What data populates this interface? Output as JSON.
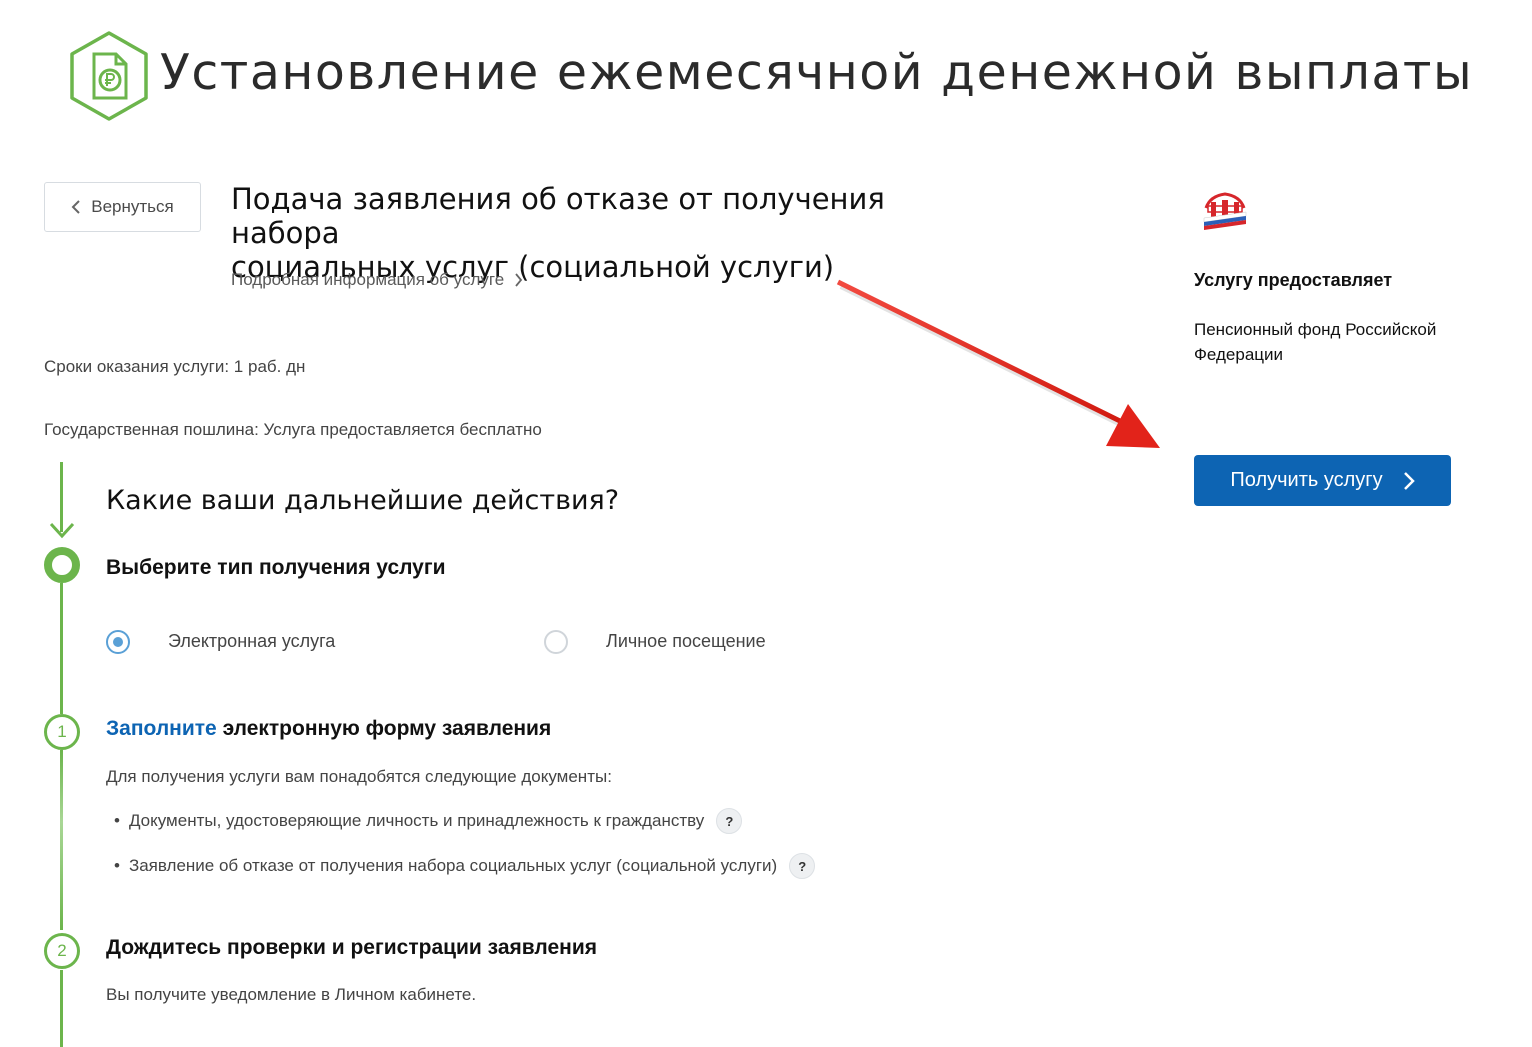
{
  "header": {
    "title": "Установление ежемесячной денежной выплаты",
    "logo_icon": "ruble-document-icon"
  },
  "back_button": {
    "label": "Вернуться",
    "icon": "chevron-left-icon"
  },
  "service": {
    "title_line1": "Подача заявления об отказе от получения набора",
    "title_line2": "социальных услуг (социальной услуги)",
    "more_info": "Подробная информация об услуге",
    "terms": "Сроки оказания услуги: 1 раб. дн",
    "fee": "Государственная пошлина: Услуга предоставляется бесплатно"
  },
  "provider": {
    "label": "Услугу предоставляет",
    "name_line1": "Пенсионный фонд Российской",
    "name_line2": "Федерации",
    "logo_icon": "pfr-logo-icon"
  },
  "get_service_button": {
    "label": "Получить услугу",
    "icon": "chevron-right-icon"
  },
  "timeline": {
    "heading": "Какие ваши дальнейшие действия?",
    "choose_type": "Выберите тип получения услуги",
    "options": [
      {
        "label": "Электронная услуга",
        "selected": true
      },
      {
        "label": "Личное посещение",
        "selected": false
      }
    ],
    "steps": [
      {
        "number": "1",
        "title_link": "Заполните",
        "title_rest": " электронную форму заявления",
        "text": "Для получения услуги вам понадобятся следующие документы:",
        "documents": [
          "Документы, удостоверяющие личность и принадлежность к гражданству",
          "Заявление об отказе от получения набора социальных услуг (социальной услуги)"
        ]
      },
      {
        "number": "2",
        "title": "Дождитесь проверки и регистрации заявления",
        "text": "Вы получите уведомление в Личном кабинете."
      }
    ],
    "help_label": "?"
  },
  "colors": {
    "accent_green": "#6cb54c",
    "primary_blue": "#0d64b3",
    "annotation_red": "#e2231a"
  }
}
